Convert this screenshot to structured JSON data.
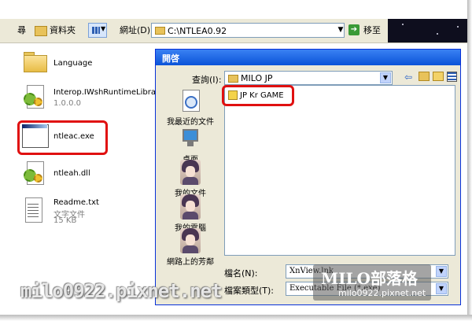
{
  "toolbar": {
    "search_label": "尋",
    "folders_label": "資料夾",
    "address_label": "網址(D)",
    "address_value": "C:\\NTLEA0.92",
    "go_label": "移至"
  },
  "files": [
    {
      "name": "Language",
      "type": "folder",
      "sub": []
    },
    {
      "name": "Interop.IWshRuntimeLibrary.dll",
      "type": "dll",
      "sub": [
        "1.0.0.0"
      ]
    },
    {
      "name": "ntleac.exe",
      "type": "exe",
      "sub": []
    },
    {
      "name": "ntleah.dll",
      "type": "dll",
      "sub": []
    },
    {
      "name": "Readme.txt",
      "type": "txt",
      "sub": [
        "文字文件",
        "15 KB"
      ]
    }
  ],
  "dialog": {
    "title": "開啓",
    "look_in_label": "查詢(I):",
    "look_in_value": "MILO JP",
    "places": [
      {
        "label": "我最近的文件",
        "icon": "recent-documents-icon"
      },
      {
        "label": "桌面",
        "icon": "desktop-icon"
      },
      {
        "label": "我的文件",
        "icon": "my-documents-icon"
      },
      {
        "label": "我的電腦",
        "icon": "my-computer-icon"
      },
      {
        "label": "網路上的芳鄰",
        "icon": "network-places-icon"
      }
    ],
    "file_items": [
      "JP Kr GAME"
    ],
    "file_name_label": "檔名(N):",
    "file_name_value": "XnView.lnk",
    "file_type_label": "檔案類型(T):",
    "file_type_value": "Executable File (*.exe)"
  },
  "watermark": {
    "blog_title": "MILO部落格",
    "blog_url": "milo0922.pixnet.net",
    "big_url": "milo0922.pixnet.net"
  }
}
